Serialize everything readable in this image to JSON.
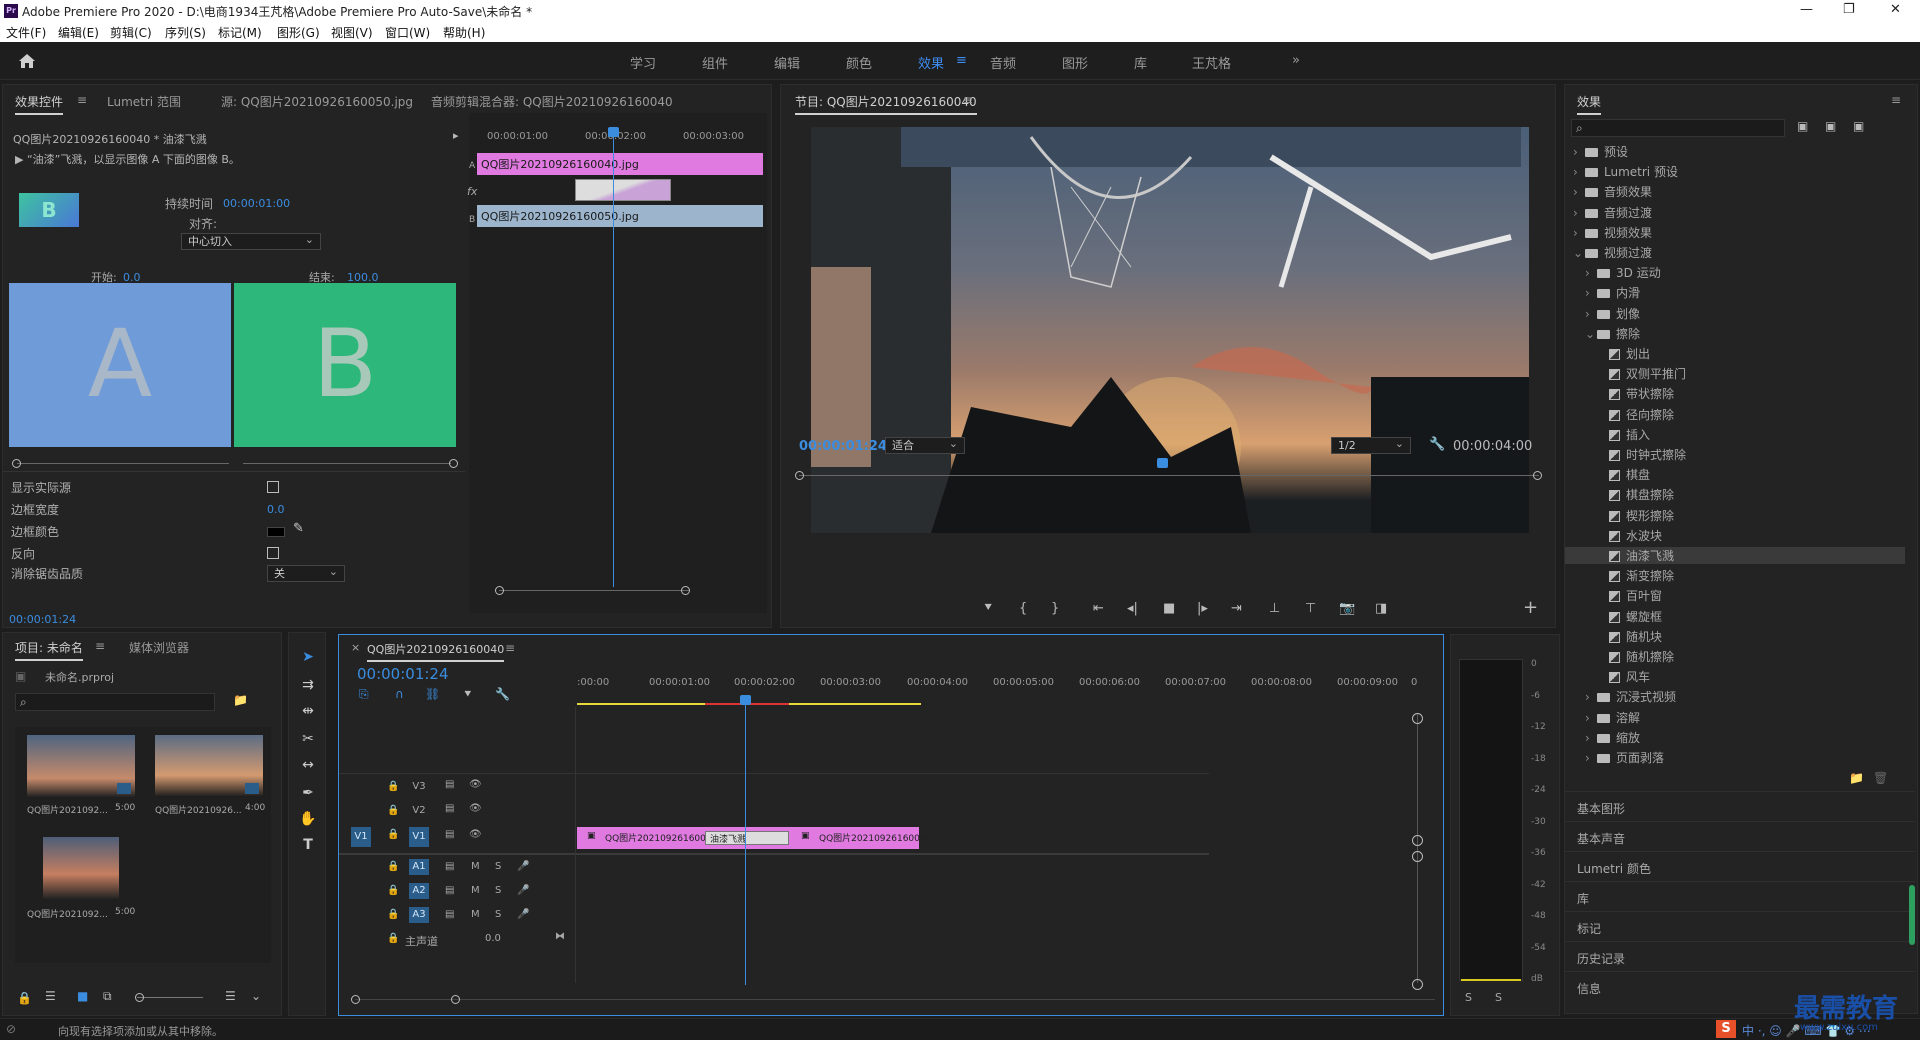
{
  "title": {
    "text": "Adobe Premiere Pro 2020 - D:\\电商1934王芃格\\Adobe Premiere Pro Auto-Save\\未命名 *",
    "logo": "Pr",
    "minimize": "—",
    "maximize": "❐",
    "close": "✕"
  },
  "menu": [
    "文件(F)",
    "编辑(E)",
    "剪辑(C)",
    "序列(S)",
    "标记(M)",
    "图形(G)",
    "视图(V)",
    "窗口(W)",
    "帮助(H)"
  ],
  "workspaces": [
    "学习",
    "组件",
    "编辑",
    "颜色",
    "效果",
    "音频",
    "图形",
    "库",
    "王芃格"
  ],
  "workspace_active": "效果",
  "workspace_more": "»",
  "effect_controls": {
    "tabs": [
      "效果控件",
      "Lumetri 范围",
      "源: QQ图片20210926160050.jpg",
      "音频剪辑混合器: QQ图片20210926160040"
    ],
    "clip_label": "QQ图片20210926160040 * 油漆飞溅",
    "description": "“油漆”飞溅，以显示图像 A 下面的图像 B。",
    "thumb_letter": "B",
    "duration_label": "持续时间",
    "duration_value": "00:00:01:00",
    "align_label": "对齐:",
    "align_value": "中心切入",
    "start_label": "开始:",
    "start_value": "0.0",
    "end_label": "结束:",
    "end_value": "100.0",
    "preview_a": "A",
    "preview_b": "B",
    "props": [
      {
        "label": "显示实际源",
        "type": "checkbox"
      },
      {
        "label": "边框宽度",
        "value": "0.0"
      },
      {
        "label": "边框颜色",
        "type": "color"
      },
      {
        "label": "反向",
        "type": "checkbox"
      },
      {
        "label": "消除锯齿品质",
        "value": "关",
        "type": "select"
      }
    ],
    "mini_ruler": [
      "00:00:01:00",
      "00:00:02:00",
      "00:00:03:00"
    ],
    "clip_a": "QQ图片20210926160040.jpg",
    "clip_b": "QQ图片20210926160050.jpg",
    "track_a": "A",
    "track_fx": "fx",
    "track_b": "B",
    "timecode": "00:00:01:24"
  },
  "program": {
    "title": "节目: QQ图片20210926160040",
    "timecode": "00:00:01:24",
    "fit": "适合",
    "resolution": "1/2",
    "duration": "00:00:04:00",
    "add_btn": "+"
  },
  "effects": {
    "title": "效果",
    "tree": [
      {
        "label": "预设",
        "level": 0,
        "kind": "folder",
        "open": false
      },
      {
        "label": "Lumetri 预设",
        "level": 0,
        "kind": "folder",
        "open": false
      },
      {
        "label": "音频效果",
        "level": 0,
        "kind": "folder",
        "open": false
      },
      {
        "label": "音频过渡",
        "level": 0,
        "kind": "folder",
        "open": false
      },
      {
        "label": "视频效果",
        "level": 0,
        "kind": "folder",
        "open": false
      },
      {
        "label": "视频过渡",
        "level": 0,
        "kind": "folder",
        "open": true
      },
      {
        "label": "3D 运动",
        "level": 1,
        "kind": "folder",
        "open": false
      },
      {
        "label": "内滑",
        "level": 1,
        "kind": "folder",
        "open": false
      },
      {
        "label": "划像",
        "level": 1,
        "kind": "folder",
        "open": false
      },
      {
        "label": "擦除",
        "level": 1,
        "kind": "folder",
        "open": true
      },
      {
        "label": "划出",
        "level": 2,
        "kind": "effect"
      },
      {
        "label": "双侧平推门",
        "level": 2,
        "kind": "effect"
      },
      {
        "label": "带状擦除",
        "level": 2,
        "kind": "effect"
      },
      {
        "label": "径向擦除",
        "level": 2,
        "kind": "effect"
      },
      {
        "label": "插入",
        "level": 2,
        "kind": "effect"
      },
      {
        "label": "时钟式擦除",
        "level": 2,
        "kind": "effect"
      },
      {
        "label": "棋盘",
        "level": 2,
        "kind": "effect"
      },
      {
        "label": "棋盘擦除",
        "level": 2,
        "kind": "effect"
      },
      {
        "label": "楔形擦除",
        "level": 2,
        "kind": "effect"
      },
      {
        "label": "水波块",
        "level": 2,
        "kind": "effect"
      },
      {
        "label": "油漆飞溅",
        "level": 2,
        "kind": "effect",
        "selected": true
      },
      {
        "label": "渐变擦除",
        "level": 2,
        "kind": "effect"
      },
      {
        "label": "百叶窗",
        "level": 2,
        "kind": "effect"
      },
      {
        "label": "螺旋框",
        "level": 2,
        "kind": "effect"
      },
      {
        "label": "随机块",
        "level": 2,
        "kind": "effect"
      },
      {
        "label": "随机擦除",
        "level": 2,
        "kind": "effect"
      },
      {
        "label": "风车",
        "level": 2,
        "kind": "effect"
      },
      {
        "label": "沉浸式视频",
        "level": 1,
        "kind": "folder",
        "open": false
      },
      {
        "label": "溶解",
        "level": 1,
        "kind": "folder",
        "open": false
      },
      {
        "label": "缩放",
        "level": 1,
        "kind": "folder",
        "open": false
      },
      {
        "label": "页面剥落",
        "level": 1,
        "kind": "folder",
        "open": false
      }
    ],
    "sections": [
      "基本图形",
      "基本声音",
      "Lumetri 颜色",
      "库",
      "标记",
      "历史记录",
      "信息"
    ]
  },
  "project": {
    "tabs": [
      "项目: 未命名",
      "媒体浏览器"
    ],
    "file": "未命名.prproj",
    "items": [
      {
        "name": "QQ图片2021092...",
        "dur": "5:00"
      },
      {
        "name": "QQ图片20210926...",
        "dur": "4:00"
      },
      {
        "name": "QQ图片2021092...",
        "dur": "5:00"
      }
    ]
  },
  "timeline": {
    "tab": "QQ图片20210926160040",
    "close": "×",
    "timecode": "00:00:01:24",
    "ruler": [
      ":00:00",
      "00:00:01:00",
      "00:00:02:00",
      "00:00:03:00",
      "00:00:04:00",
      "00:00:05:00",
      "00:00:06:00",
      "00:00:07:00",
      "00:00:08:00",
      "00:00:09:00",
      "0"
    ],
    "video_tracks": [
      "V3",
      "V2",
      "V1"
    ],
    "source_patch": "V1",
    "audio_tracks": [
      "A1",
      "A2",
      "A3"
    ],
    "btn_m": "M",
    "btn_s": "S",
    "master": "主声道",
    "master_value": "0.0",
    "clip1": "QQ图片2021092616000",
    "transition": "油漆飞溅",
    "clip2": "QQ图片20210926160040"
  },
  "meter": {
    "ticks": [
      "0",
      "-6",
      "-12",
      "-18",
      "-24",
      "-30",
      "-36",
      "-42",
      "-48",
      "-54",
      "dB"
    ],
    "solo": "S"
  },
  "status": {
    "text": "向现有选择项添加或从其中移除。"
  },
  "watermark": {
    "text": "最需教育",
    "url": "www.zuixu.com"
  },
  "ime": {
    "brand": "S",
    "text": "中 ·, ☺ 🎤 ⌨ 👕 ⚙ ⋯"
  },
  "colors": {
    "accent": "#3b8de0",
    "clip_pink": "#e07ae0",
    "clip_blue": "#9cb5cc",
    "preview_a": "#6f9bd8",
    "preview_b": "#2db77a"
  }
}
